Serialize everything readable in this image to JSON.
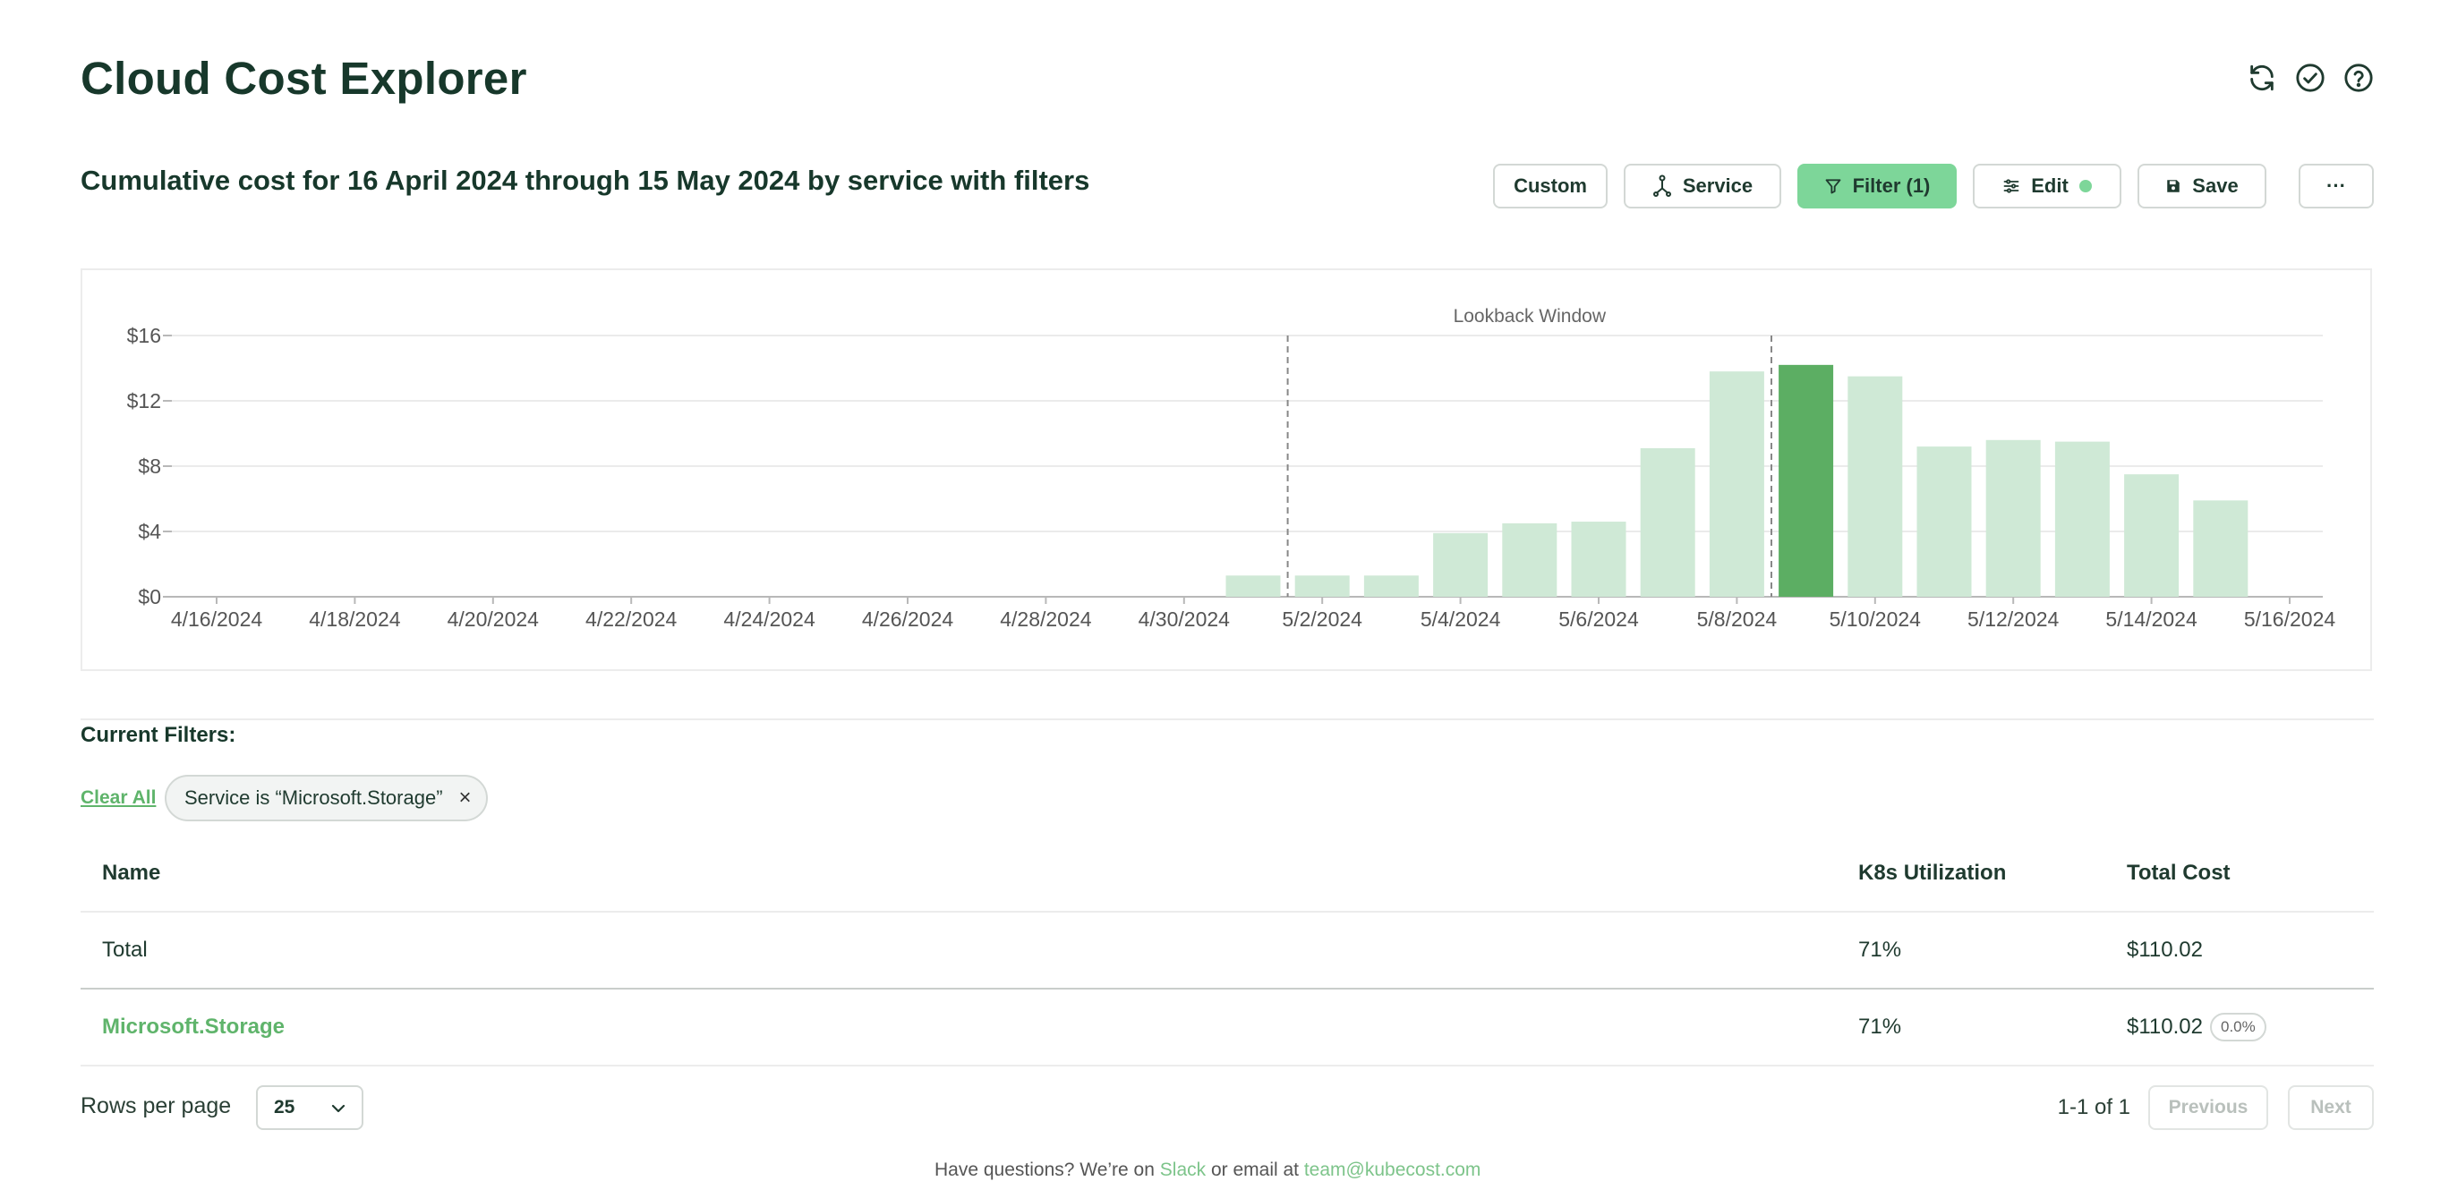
{
  "header": {
    "title": "Cloud Cost Explorer",
    "icons": [
      "refresh-icon",
      "check-circle-icon",
      "help-icon"
    ]
  },
  "report": {
    "subtitle": "Cumulative cost for 16 April 2024 through 15 May 2024 by service with filters"
  },
  "toolbar": {
    "custom_label": "Custom",
    "service_label": "Service",
    "filter_label": "Filter (1)",
    "edit_label": "Edit",
    "save_label": "Save",
    "more_label": "···"
  },
  "colors": {
    "accent": "#7dd699",
    "bar_light": "#cfe9d6",
    "bar_highlight": "#5cae63",
    "title_text": "#17382b",
    "link": "#5fb46b"
  },
  "chart_data": {
    "type": "bar",
    "annotation": "Lookback Window",
    "x_tick_labels": [
      "4/16/2024",
      "4/18/2024",
      "4/20/2024",
      "4/22/2024",
      "4/24/2024",
      "4/26/2024",
      "4/28/2024",
      "4/30/2024",
      "5/2/2024",
      "5/4/2024",
      "5/6/2024",
      "5/8/2024",
      "5/10/2024",
      "5/12/2024",
      "5/14/2024",
      "5/16/2024"
    ],
    "y_tick_labels": [
      "$16",
      "$12",
      "$8",
      "$4",
      "$0"
    ],
    "ylim": [
      0,
      16
    ],
    "categories": [
      "5/1/2024",
      "5/2/2024",
      "5/3/2024",
      "5/4/2024",
      "5/5/2024",
      "5/6/2024",
      "5/7/2024",
      "5/8/2024",
      "5/9/2024",
      "5/10/2024",
      "5/11/2024",
      "5/12/2024",
      "5/13/2024",
      "5/14/2024",
      "5/15/2024"
    ],
    "values": [
      1.3,
      1.3,
      1.3,
      3.9,
      4.5,
      4.6,
      9.1,
      13.8,
      14.2,
      13.5,
      9.2,
      9.6,
      9.5,
      7.5,
      5.9
    ],
    "highlighted_category": "5/9/2024",
    "lookback_window": [
      "5/1/2024",
      "5/8/2024"
    ],
    "grid": true
  },
  "filters": {
    "label": "Current Filters:",
    "clear_all": "Clear All",
    "chips": [
      {
        "text": "Service is “Microsoft.Storage”",
        "remove": "×"
      }
    ]
  },
  "table": {
    "headers": {
      "name": "Name",
      "util": "K8s Utilization",
      "cost": "Total Cost"
    },
    "total": {
      "name": "Total",
      "util": "71%",
      "cost": "$110.02"
    },
    "rows": [
      {
        "name": "Microsoft.Storage",
        "util": "71%",
        "cost": "$110.02",
        "badge": "0.0%"
      }
    ]
  },
  "pagination": {
    "rows_label": "Rows per page",
    "rows_value": "25",
    "count": "1-1 of 1",
    "previous": "Previous",
    "next": "Next"
  },
  "footer": {
    "pre": "Have questions? We’re on ",
    "slack": "Slack",
    "mid": " or email at ",
    "email": "team@kubecost.com"
  }
}
